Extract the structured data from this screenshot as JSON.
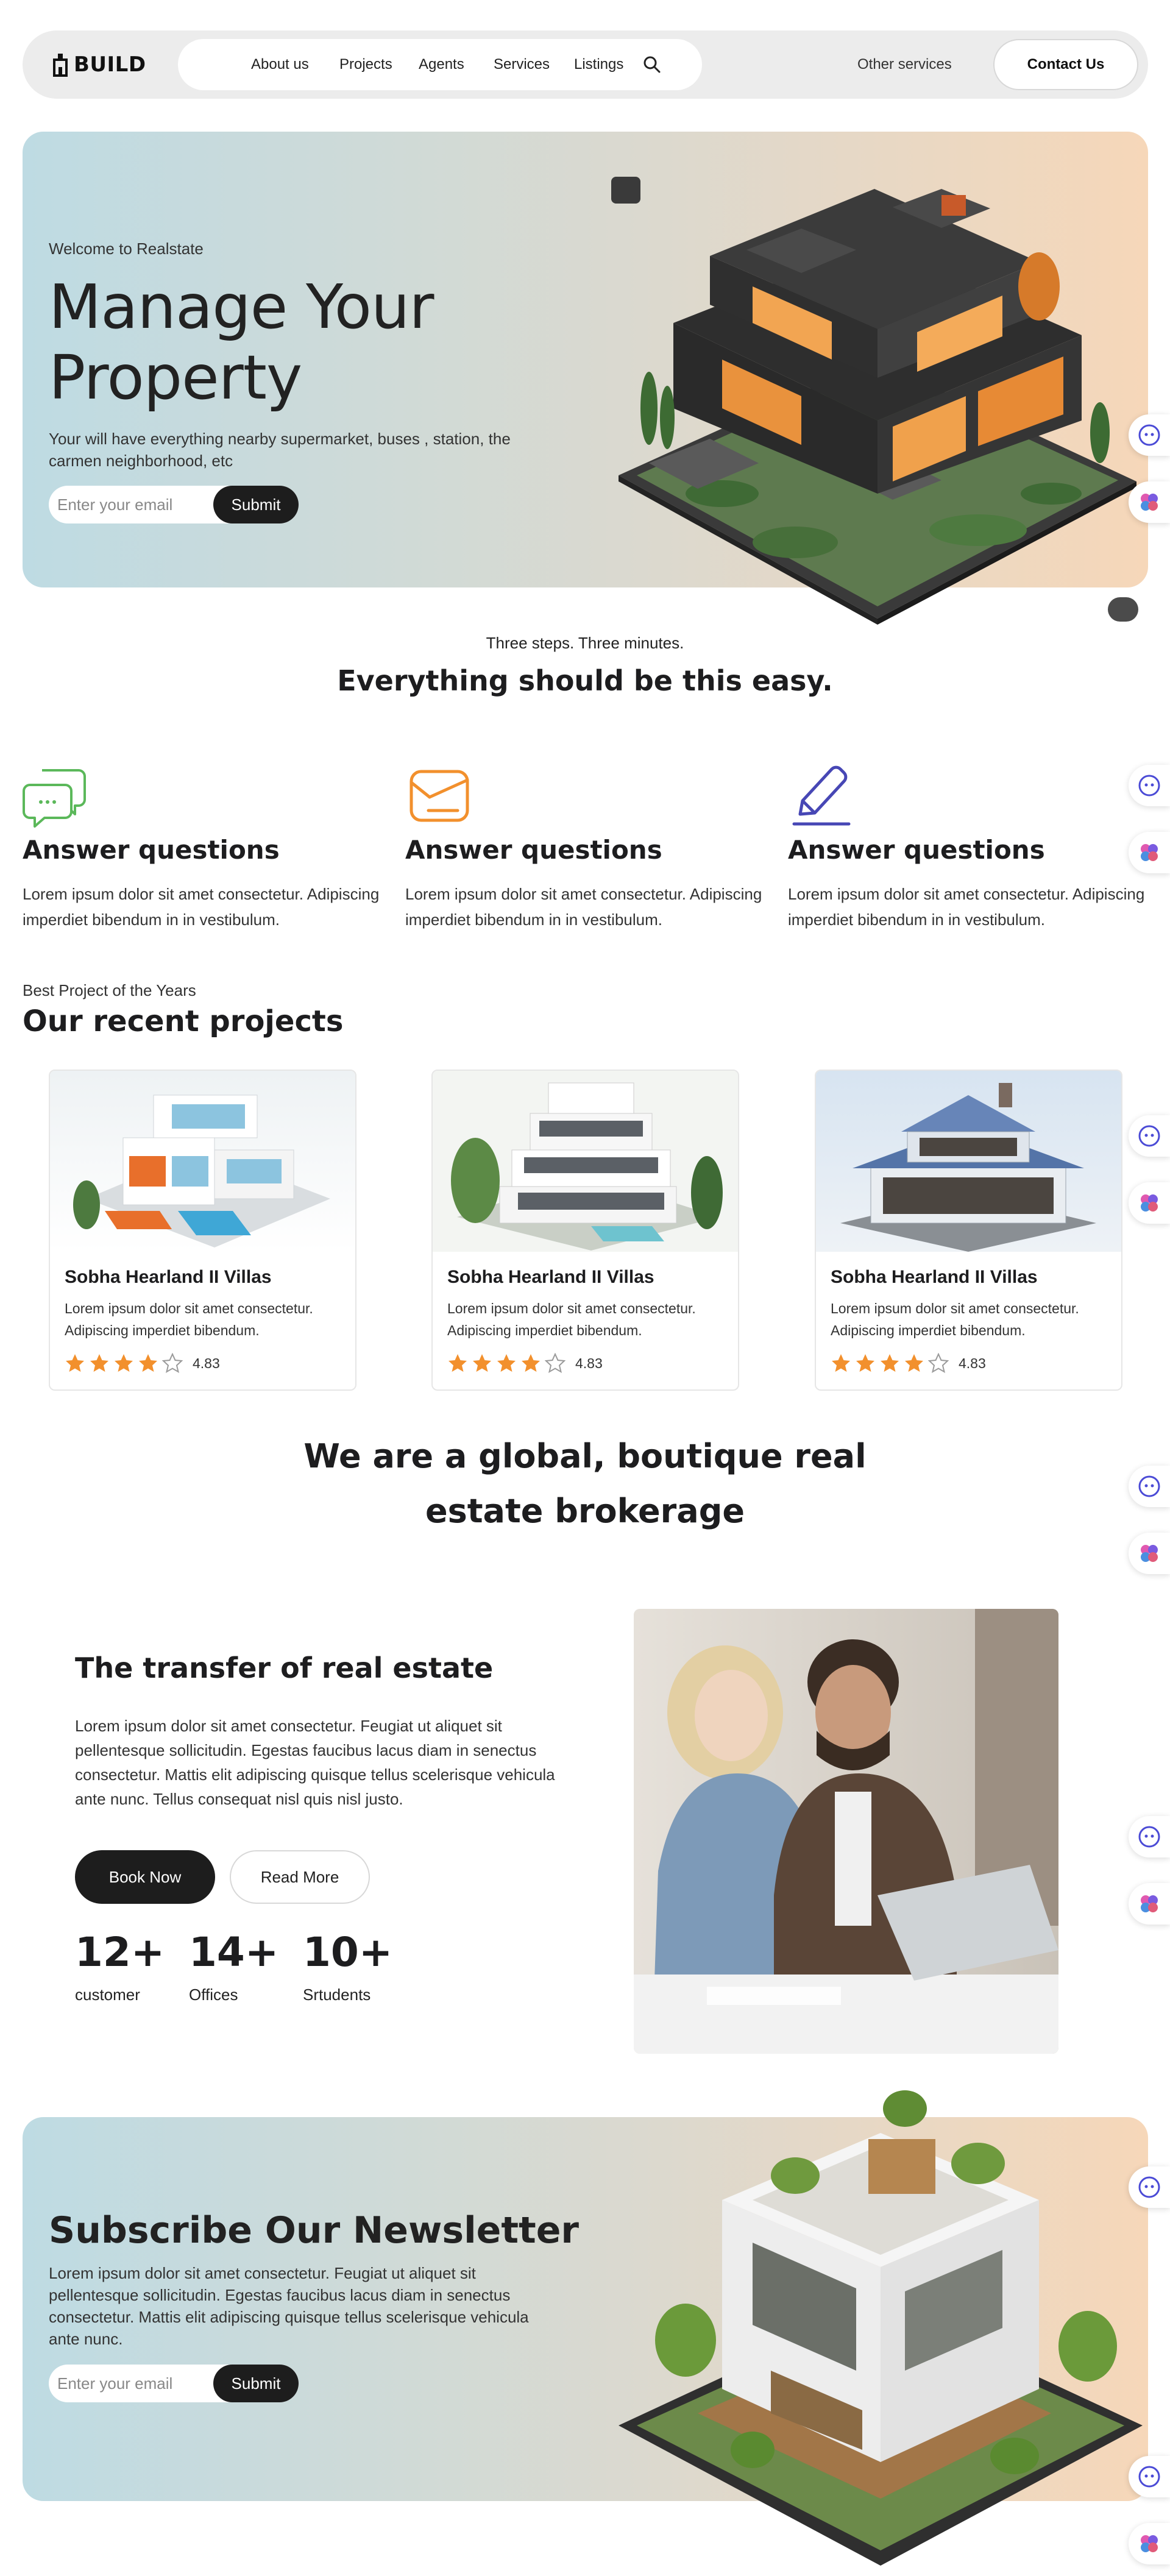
{
  "brand": {
    "name": "BUILD"
  },
  "nav": {
    "links": [
      "About us",
      "Projects",
      "Agents",
      "Services",
      "Listings"
    ],
    "other": "Other services",
    "contact": "Contact Us"
  },
  "hero": {
    "welcome": "Welcome to Realstate",
    "title": "Manage Your Property",
    "description": "Your will have everything nearby supermarket, buses , station, the carmen neighborhood, etc",
    "email_placeholder": "Enter your email",
    "submit": "Submit"
  },
  "steps": {
    "eyebrow": "Three steps. Three minutes.",
    "title": "Everything should be this easy.",
    "items": [
      {
        "icon": "chat-bubbles-icon",
        "color": "#5bb85a",
        "title": "Answer questions",
        "text": "Lorem ipsum dolor sit amet consectetur. Adipiscing imperdiet bibendum in in vestibulum."
      },
      {
        "icon": "envelope-icon",
        "color": "#f2902d",
        "title": "Answer questions",
        "text": "Lorem ipsum dolor sit amet consectetur. Adipiscing imperdiet bibendum in in vestibulum."
      },
      {
        "icon": "pencil-icon",
        "color": "#4747b5",
        "title": "Answer questions",
        "text": "Lorem ipsum dolor sit amet consectetur. Adipiscing imperdiet bibendum in in vestibulum."
      }
    ]
  },
  "projects": {
    "eyebrow": "Best Project of the Years",
    "title": "Our recent projects",
    "cards": [
      {
        "title": "Sobha Hearland II Villas",
        "text": "Lorem ipsum dolor sit amet consectetur. Adipiscing imperdiet bibendum.",
        "rating": "4.83",
        "stars": 4
      },
      {
        "title": "Sobha Hearland II Villas",
        "text": "Lorem ipsum dolor sit amet consectetur. Adipiscing imperdiet bibendum.",
        "rating": "4.83",
        "stars": 4
      },
      {
        "title": "Sobha Hearland II Villas",
        "text": "Lorem ipsum dolor sit amet consectetur. Adipiscing imperdiet bibendum.",
        "rating": "4.83",
        "stars": 4
      }
    ]
  },
  "global": {
    "title": "We are a global, boutique real estate brokerage"
  },
  "transfer": {
    "title": "The transfer of real estate",
    "text": "Lorem ipsum dolor sit amet consectetur. Feugiat ut aliquet sit pellentesque sollicitudin. Egestas faucibus lacus diam in senectus consectetur. Mattis elit adipiscing quisque tellus scelerisque vehicula ante nunc. Tellus consequat nisl quis nisl justo.",
    "book": "Book Now",
    "read": "Read More",
    "stats": [
      {
        "value": "12+",
        "label": "customer"
      },
      {
        "value": "14+",
        "label": "Offices"
      },
      {
        "value": "10+",
        "label": "Srtudents"
      }
    ]
  },
  "newsletter": {
    "title": "Subscribe Our Newsletter",
    "text": "Lorem ipsum dolor sit amet consectetur. Feugiat ut aliquet sit pellentesque sollicitudin. Egestas faucibus lacus diam in senectus consectetur. Mattis elit adipiscing quisque tellus scelerisque vehicula ante nunc.",
    "email_placeholder": "Enter your email",
    "submit": "Submit"
  },
  "colors": {
    "dark": "#1d1d1d",
    "star": "#f2902d",
    "hero_gradient": [
      "#bedbe3",
      "#f6d7b9"
    ]
  }
}
